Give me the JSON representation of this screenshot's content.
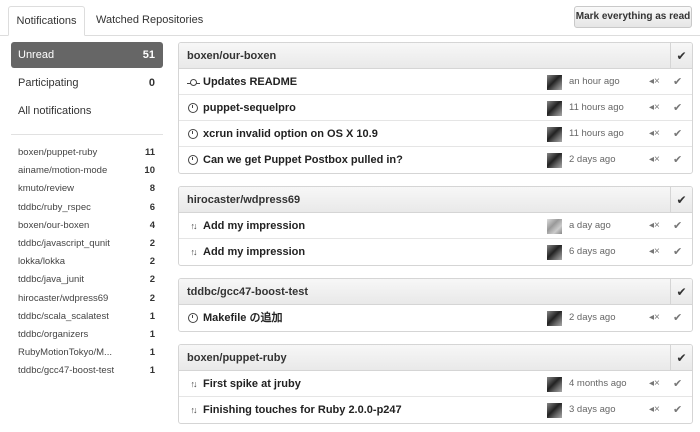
{
  "tabs": {
    "notifications": "Notifications",
    "watched": "Watched Repositories"
  },
  "mark_all_label": "Mark everything as read",
  "filters": [
    {
      "label": "Unread",
      "count": "51"
    },
    {
      "label": "Participating",
      "count": "0"
    },
    {
      "label": "All notifications",
      "count": ""
    }
  ],
  "repos": [
    {
      "name": "boxen/puppet-ruby",
      "count": "11"
    },
    {
      "name": "ainame/motion-mode",
      "count": "10"
    },
    {
      "name": "kmuto/review",
      "count": "8"
    },
    {
      "name": "tddbc/ruby_rspec",
      "count": "6"
    },
    {
      "name": "boxen/our-boxen",
      "count": "4"
    },
    {
      "name": "tddbc/javascript_qunit",
      "count": "2"
    },
    {
      "name": "lokka/lokka",
      "count": "2"
    },
    {
      "name": "tddbc/java_junit",
      "count": "2"
    },
    {
      "name": "hirocaster/wdpress69",
      "count": "2"
    },
    {
      "name": "tddbc/scala_scalatest",
      "count": "1"
    },
    {
      "name": "tddbc/organizers",
      "count": "1"
    },
    {
      "name": "RubyMotionTokyo/M...",
      "count": "1"
    },
    {
      "name": "tddbc/gcc47-boost-test",
      "count": "1"
    }
  ],
  "groups": [
    {
      "repo": "boxen/our-boxen",
      "items": [
        {
          "type": "commit",
          "icon": "commit-icon",
          "title": "Updates README",
          "time": "an hour ago"
        },
        {
          "type": "issue",
          "icon": "issue-icon",
          "title": "puppet-sequelpro",
          "time": "11 hours ago"
        },
        {
          "type": "issue",
          "icon": "issue-icon",
          "title": "xcrun invalid option on OS X 10.9",
          "time": "11 hours ago"
        },
        {
          "type": "issue",
          "icon": "issue-icon",
          "title": "Can we get Puppet Postbox pulled in?",
          "time": "2 days ago"
        }
      ]
    },
    {
      "repo": "hirocaster/wdpress69",
      "items": [
        {
          "type": "pr",
          "icon": "pull-request-icon",
          "title": "Add my impression",
          "time": "a day ago"
        },
        {
          "type": "pr",
          "icon": "pull-request-icon",
          "title": "Add my impression",
          "time": "6 days ago"
        }
      ]
    },
    {
      "repo": "tddbc/gcc47-boost-test",
      "items": [
        {
          "type": "issue",
          "icon": "issue-icon",
          "title": "Makefile の追加",
          "time": "2 days ago"
        }
      ]
    },
    {
      "repo": "boxen/puppet-ruby",
      "items": [
        {
          "type": "pr",
          "icon": "pull-request-icon",
          "title": "First spike at jruby",
          "time": "4 months ago"
        },
        {
          "type": "pr",
          "icon": "pull-request-icon",
          "title": "Finishing touches for Ruby 2.0.0-p247",
          "time": "3 days ago"
        }
      ]
    }
  ],
  "icons": {
    "mute": "mute-icon",
    "done": "check-icon"
  }
}
